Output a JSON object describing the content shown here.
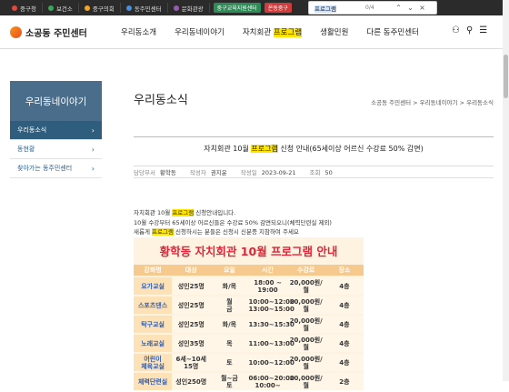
{
  "topbar": {
    "links": [
      {
        "label": "중구청",
        "color": "#e8453c"
      },
      {
        "label": "보건소",
        "color": "#3aa757"
      },
      {
        "label": "중구의회",
        "color": "#f4a522"
      },
      {
        "label": "동주민센터",
        "color": "#4a8fdb"
      },
      {
        "label": "문화관광",
        "color": "#9b59b6"
      }
    ],
    "chips": [
      {
        "label": "중구교육지원센터",
        "color": "#2e8b57"
      },
      {
        "label": "온동중구",
        "color": "#d23b3b"
      }
    ]
  },
  "find": {
    "query": "프로그램",
    "count": "0/4"
  },
  "header": {
    "logo_text": "소공동 주민센터",
    "nav": [
      {
        "label": "우리동소개"
      },
      {
        "label": "우리동네이야기"
      },
      {
        "pre": "자치회관 ",
        "mark": "프로그램"
      },
      {
        "label": "생활민원"
      },
      {
        "label": "다른 동주민센터"
      }
    ]
  },
  "sidebar": {
    "title": "우리동네이야기",
    "items": [
      {
        "label": "우리동소식",
        "active": true
      },
      {
        "label": "동현황",
        "active": false
      },
      {
        "label": "찾아가는 동주민센터",
        "active": false
      }
    ]
  },
  "page": {
    "title": "우리동소식",
    "breadcrumb": "소공동 주민센터 > 우리동네이야기 > 우리동소식"
  },
  "post": {
    "title_pre": "자치회관 10월 ",
    "title_mark": "프로그램",
    "title_post": " 신청 안내(65세이상 어르신 수강료 50% 감면)",
    "meta": {
      "dept_label": "담당부서",
      "dept": "황학동",
      "author_label": "작성자",
      "author": "권지윤",
      "date_label": "작성일",
      "date": "2023-09-21",
      "views_label": "조회",
      "views": "50"
    },
    "line1_pre": "자치회관 10월 ",
    "line1_mark": "프로그램",
    "line1_post": " 신청안내입니다.",
    "line2": "10월 수강부터 65세이상 어르신들은 수강료 50% 감면되오니(체력단련실 제외)",
    "line3_pre": "새롭게 ",
    "line3_mark": "프로그램",
    "line3_post": " 신청하시는 분들은 신청시 신분증 지참하여 주세요"
  },
  "poster": {
    "heading": "황학동 자치회관 10월 프로그램 안내",
    "columns": [
      "강좌명",
      "대상",
      "요일",
      "시간",
      "수강료",
      "장소"
    ],
    "rows": [
      {
        "name": "요가교실",
        "target": "성인25명",
        "day": "화/목",
        "time": "18:00 ~ 19:00",
        "fee": "20,000원/월",
        "place": "4층"
      },
      {
        "name": "스포츠댄스",
        "target": "성인25명",
        "day": "월\n금",
        "time": "10:00~12:00\n13:00~15:00",
        "fee": "20,000원/월",
        "place": "4층"
      },
      {
        "name": "탁구교실",
        "target": "성인25명",
        "day": "화/목",
        "time": "13:30~15:30",
        "fee": "20,000원/월",
        "place": "4층"
      },
      {
        "name": "노래교실",
        "target": "성인35명",
        "day": "목",
        "time": "11:00~13:00",
        "fee": "20,000원/월",
        "place": "4층"
      },
      {
        "name": "어린이\n체육교실",
        "target": "6세~10세\n15명",
        "day": "토",
        "time": "10:00~12:00",
        "fee": "20,000원/월",
        "place": "4층"
      },
      {
        "name": "체력단련실",
        "target": "성인250명",
        "day": "월~금\n토",
        "time": "06:00~20:00\n10:00~",
        "fee": "20,000원/월",
        "place": "2층"
      }
    ]
  }
}
